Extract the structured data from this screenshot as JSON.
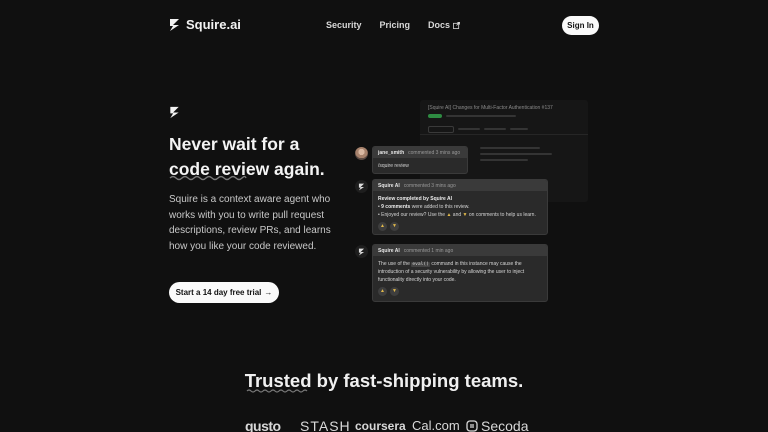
{
  "header": {
    "logo_text": "Squire.ai",
    "nav": [
      "Security",
      "Pricing",
      "Docs"
    ],
    "signin_label": "Sign In"
  },
  "hero": {
    "title_line1": "Never wait for a",
    "title_line2": "code review again.",
    "description": "Squire is a context aware agent who works with you to write pull request descriptions, review PRs, and learns how you like your code reviewed.",
    "cta_label": "Start a 14 day free trial",
    "cta_arrow": "→"
  },
  "mock": {
    "pr_title": "[Squire AI] Changes for Multi-Factor Authentication #137",
    "user_comment": {
      "author": "jane_smith",
      "time": "commented 3 mins ago",
      "body": "/squire review"
    },
    "review_comment": {
      "author": "Squire AI",
      "time": "commented 3 mins ago",
      "heading": "Review completed by Squire AI",
      "bullet1_bold": "9 comments",
      "bullet1_rest": " were added to this review.",
      "bullet2_pre": "Enjoyed our review? Use the ",
      "bullet2_mid": " and ",
      "bullet2_post": " on comments to help us learn."
    },
    "code_comment": {
      "author": "Squire AI",
      "time": "commented 1 min ago",
      "body_pre": "The use of the ",
      "code": "eval()",
      "body_post": " command in this instance may cause the introduction of a security vulnerability by allowing the user to inject functionality directly into your code."
    }
  },
  "trusted": {
    "title": "Trusted by fast-shipping teams.",
    "brands": [
      "qusto",
      "STASH",
      "coursera",
      "Cal.com",
      "Secoda"
    ]
  },
  "colors": {
    "background": "#101010",
    "button_bg": "#fafafa",
    "badge_green": "#2e8b42"
  },
  "icons": [
    "squire-logo-icon",
    "external-link-icon",
    "thumbs-up-icon",
    "thumbs-down-icon",
    "arrow-right-icon",
    "secoda-icon"
  ]
}
